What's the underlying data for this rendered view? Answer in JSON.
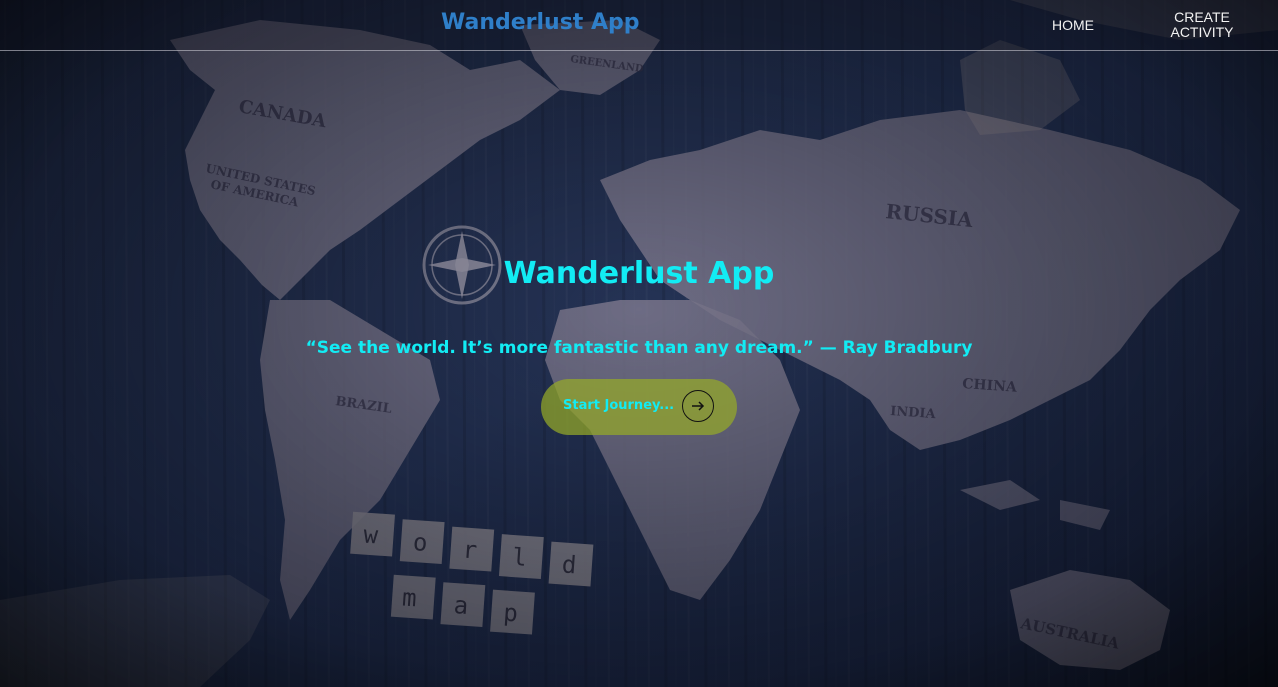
{
  "navbar": {
    "brand": "Wanderlust App",
    "links": [
      {
        "label": "HOME"
      },
      {
        "label_line1": "CREATE",
        "label_line2": "ACTIVITY"
      }
    ]
  },
  "hero": {
    "title": "Wanderlust App",
    "quote": "“See the world. It’s more fantastic than any dream.” — Ray Bradbury",
    "cta_label": "Start Journey...",
    "cta_icon": "arrow-right-icon"
  },
  "background": {
    "map_labels": [
      "CANADA",
      "UNITED STATES OF AMERICA",
      "GREENLAND",
      "RUSSIA",
      "CHINA",
      "INDIA",
      "BRAZIL",
      "AUSTRALIA"
    ],
    "tiles_row1": [
      "w",
      "o",
      "r",
      "l",
      "d"
    ],
    "tiles_row2": [
      "m",
      "a",
      "p"
    ]
  },
  "colors": {
    "brand": "#2f7fc9",
    "accent": "#12ecf4",
    "cta_bg": "#96aa28",
    "nav_text": "#f2f2f2"
  }
}
